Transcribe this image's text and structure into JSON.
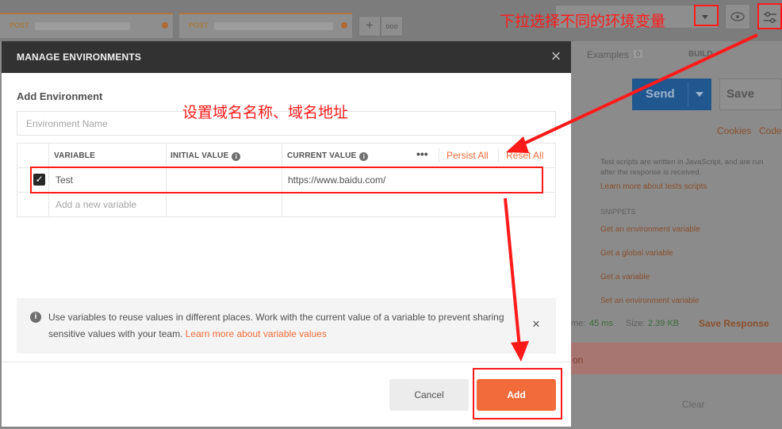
{
  "background": {
    "tabs": [
      {
        "method": "POST"
      },
      {
        "method": "POST"
      }
    ],
    "add_tab": "+",
    "tab_menu": "ooo",
    "examples_label": "Examples",
    "examples_count": "0",
    "build_label": "BUILD",
    "send_label": "Send",
    "save_label": "Save",
    "cookies_label": "Cookies",
    "code_label": "Code",
    "tests_help": "Test scripts are written in JavaScript, and are run after the response is received.",
    "tests_learn_more": "Learn more about tests scripts",
    "snippets_heading": "SNIPPETS",
    "snippets": [
      "Get an environment variable",
      "Get a global variable",
      "Get a variable",
      "Set an environment variable"
    ],
    "time_label": "me:",
    "time_value": "45 ms",
    "size_label": "Size:",
    "size_value": "2.39 KB",
    "save_response_label": "Save Response",
    "error_fragment": "on",
    "clear_label": "Clear"
  },
  "modal": {
    "title": "MANAGE ENVIRONMENTS",
    "section_label": "Add Environment",
    "env_name_placeholder": "Environment Name",
    "columns": {
      "variable": "VARIABLE",
      "initial_value": "INITIAL VALUE",
      "current_value": "CURRENT VALUE"
    },
    "more_dots": "•••",
    "persist_all": "Persist All",
    "reset_all": "Reset All",
    "rows": [
      {
        "checked": true,
        "variable": "Test",
        "initial_value": "",
        "current_value": "https://www.baidu.com/"
      }
    ],
    "new_variable_placeholder": "Add a new variable",
    "notice_text": "Use variables to reuse values in different places. Work with the current value of a variable to prevent sharing sensitive values with your team.",
    "notice_link": "Learn more about variable values",
    "cancel_label": "Cancel",
    "add_label": "Add"
  },
  "annotations": {
    "env_dropdown_note": "下拉选择不同的环境变量",
    "domain_note": "设置域名名称、域名地址",
    "color": "#ff1a1a"
  },
  "colors": {
    "accent": "#f26b3a",
    "header_dark": "#323232",
    "send_blue": "#21578f"
  }
}
